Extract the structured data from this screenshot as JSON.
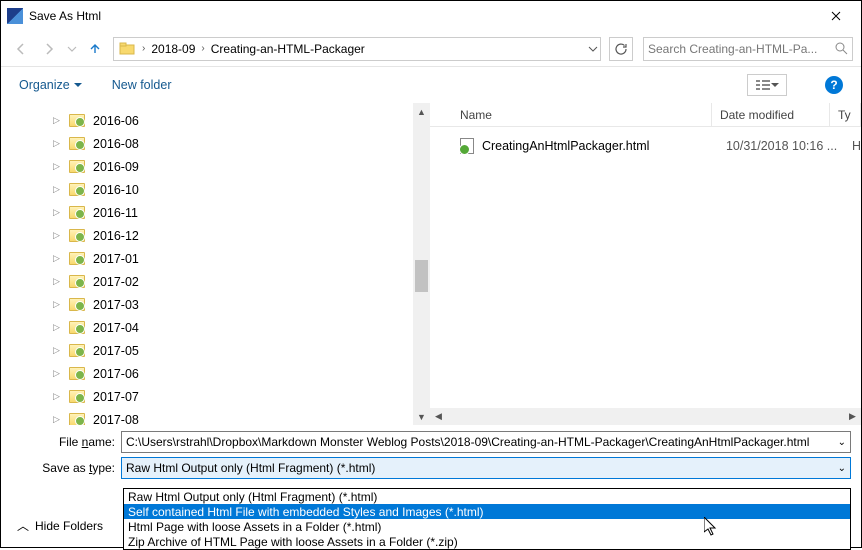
{
  "title": "Save As Html",
  "nav": {
    "breadcrumb": [
      "2018-09",
      "Creating-an-HTML-Packager"
    ],
    "search_placeholder": "Search Creating-an-HTML-Pa..."
  },
  "toolbar": {
    "organize": "Organize",
    "newfolder": "New folder"
  },
  "tree": [
    "2016-06",
    "2016-08",
    "2016-09",
    "2016-10",
    "2016-11",
    "2016-12",
    "2017-01",
    "2017-02",
    "2017-03",
    "2017-04",
    "2017-05",
    "2017-06",
    "2017-07",
    "2017-08"
  ],
  "files": {
    "col_name": "Name",
    "col_date": "Date modified",
    "col_type": "Ty",
    "rows": [
      {
        "name": "CreatingAnHtmlPackager.html",
        "date": "10/31/2018 10:16 ...",
        "type": "H"
      }
    ]
  },
  "form": {
    "filename_label": "File name:",
    "filename_value": "C:\\Users\\rstrahl\\Dropbox\\Markdown Monster Weblog Posts\\2018-09\\Creating-an-HTML-Packager\\CreatingAnHtmlPackager.html",
    "type_label": "Save as type:",
    "type_value": "Raw Html Output only (Html Fragment) (*.html)"
  },
  "type_options": [
    "Raw Html Output only (Html Fragment) (*.html)",
    "Self contained Html File with embedded Styles and Images (*.html)",
    "Html Page with loose Assets in a Folder (*.html)",
    "Zip Archive of HTML Page  with loose Assets in a Folder (*.zip)"
  ],
  "type_highlight_index": 1,
  "hide_folders": "Hide Folders"
}
